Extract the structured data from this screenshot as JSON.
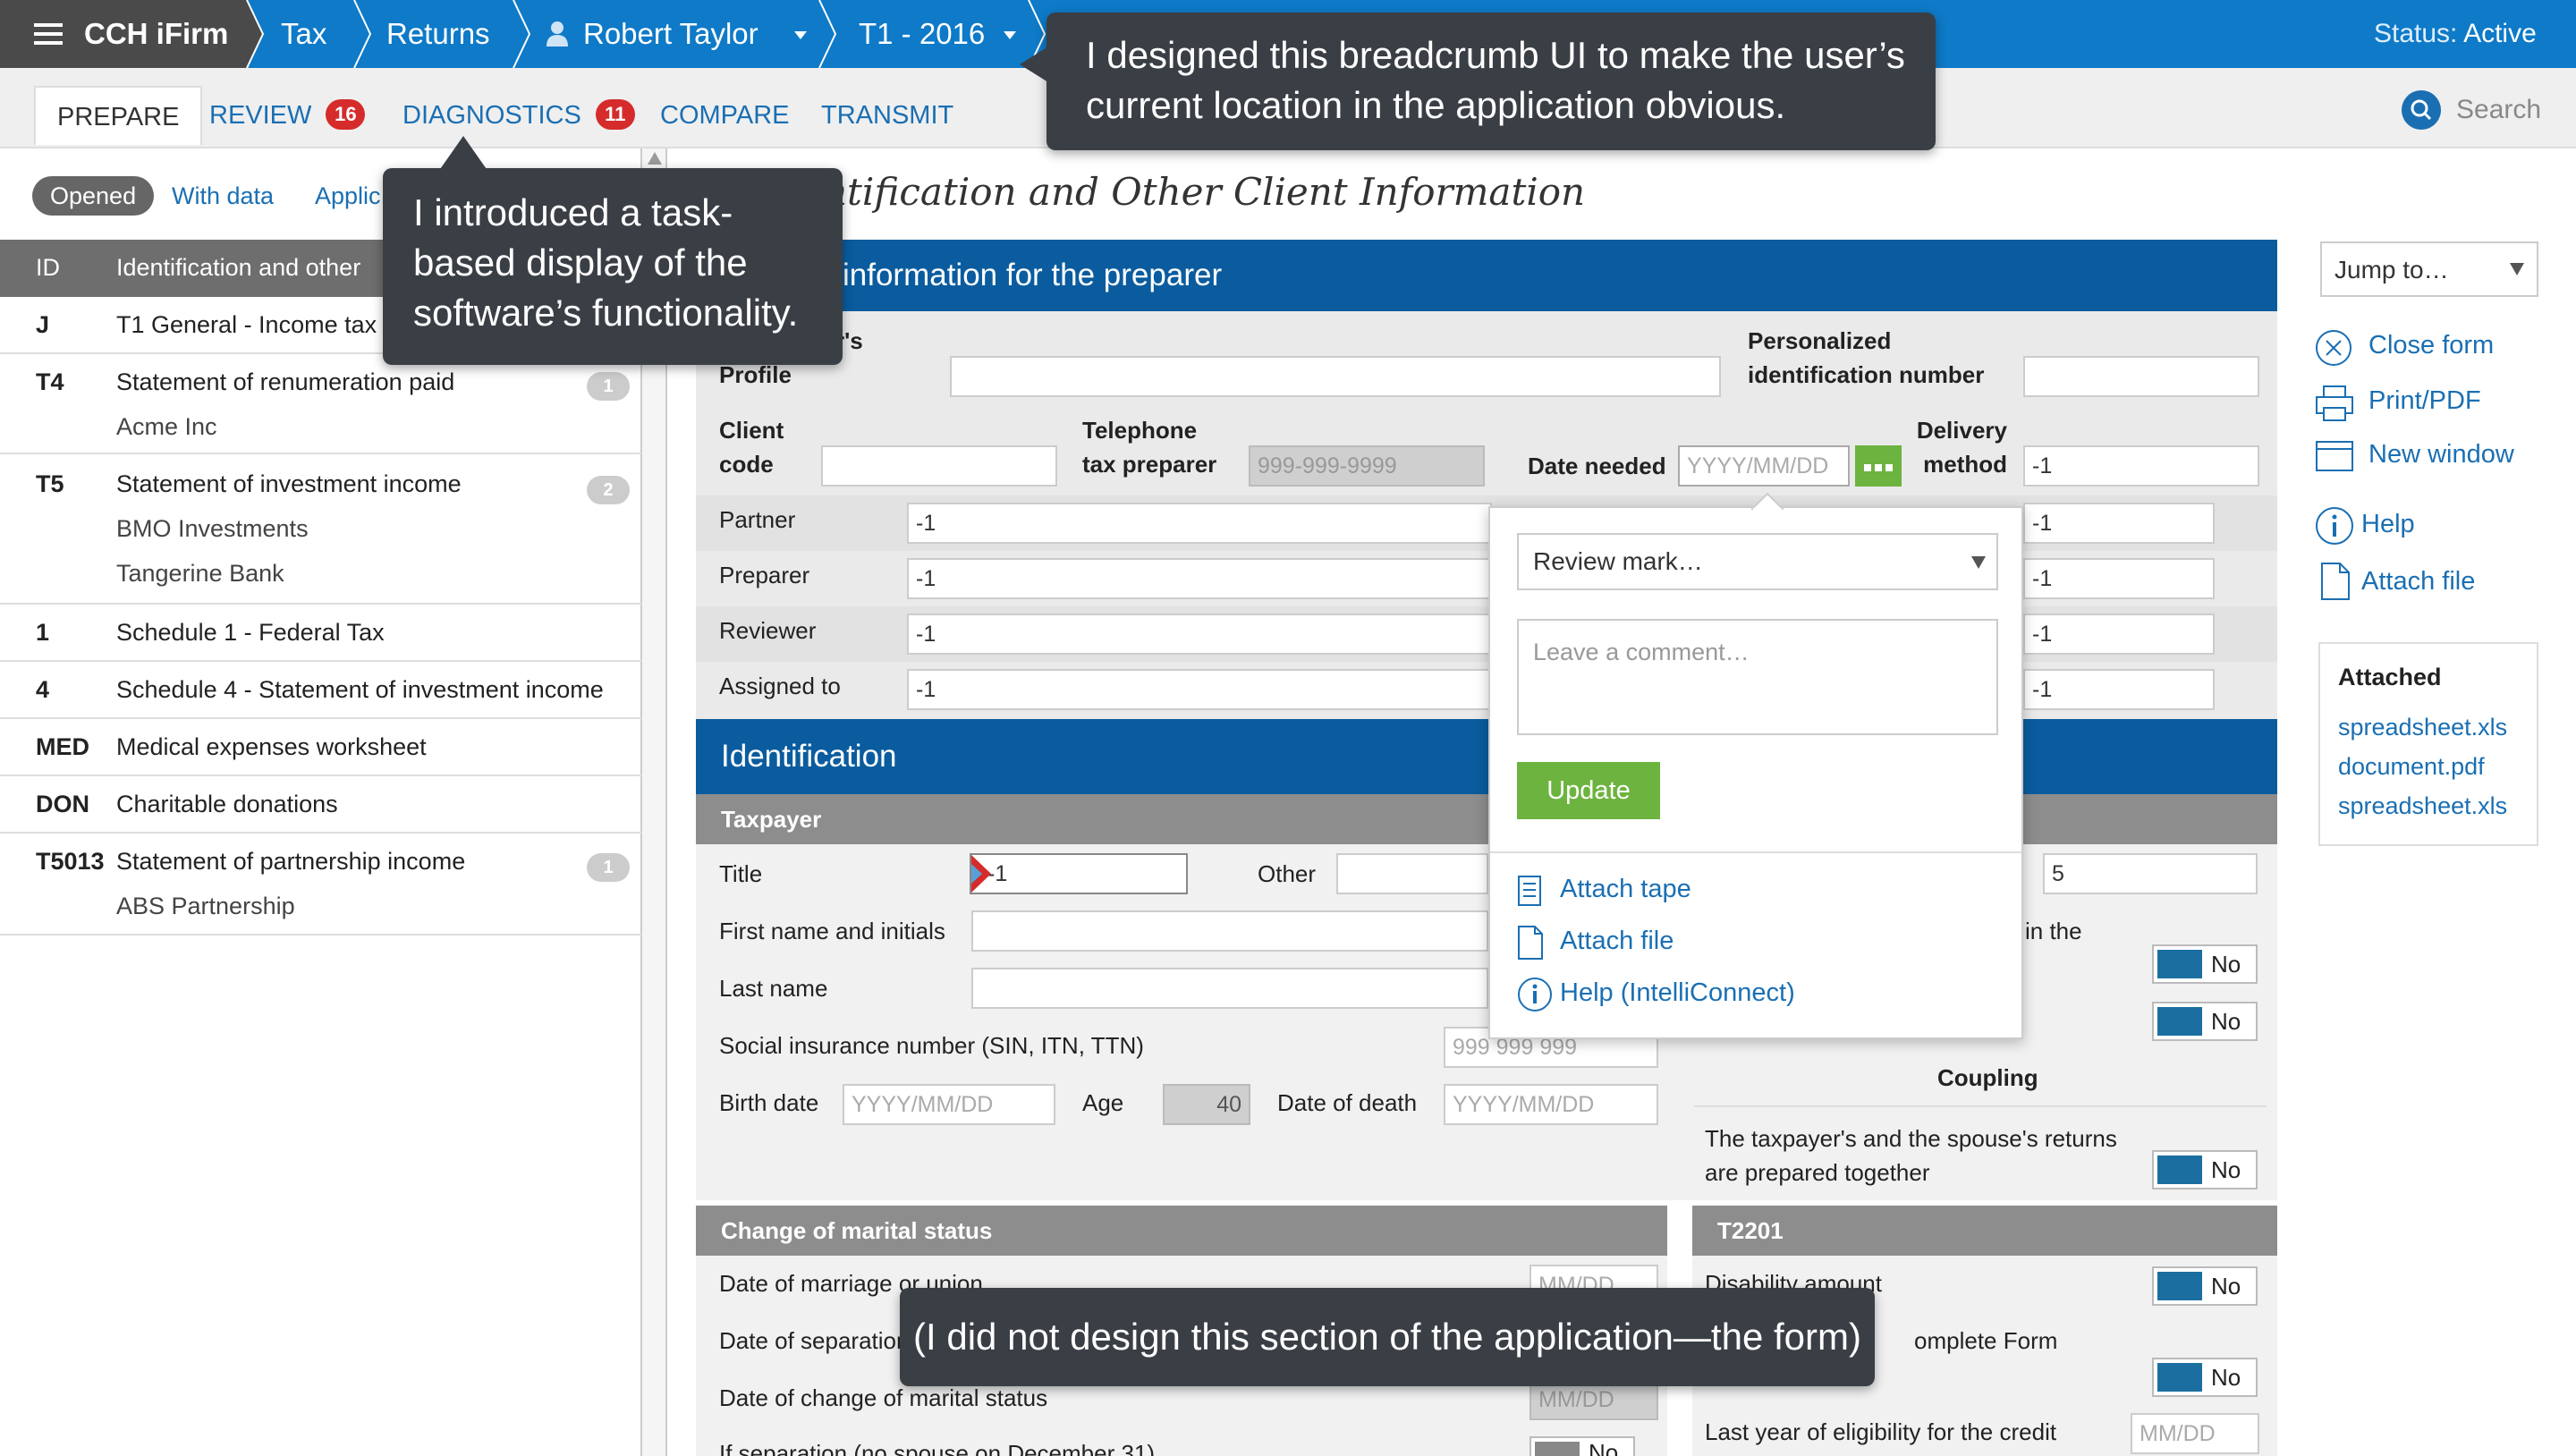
{
  "topbar": {
    "brand": "CCH iFirm",
    "crumbs": [
      "Tax",
      "Returns",
      "Robert Taylor",
      "T1 - 2016"
    ],
    "status_label": "Status:",
    "status_value": "Active"
  },
  "tabs": [
    {
      "label": "PREPARE",
      "active": true
    },
    {
      "label": "REVIEW",
      "badge": "16"
    },
    {
      "label": "DIAGNOSTICS",
      "badge": "11"
    },
    {
      "label": "COMPARE"
    },
    {
      "label": "TRANSMIT"
    }
  ],
  "search_label": "Search",
  "filters": [
    "Opened",
    "With data",
    "Applic"
  ],
  "list": {
    "header_code": "ID",
    "header_name": "Identification and other",
    "rows": [
      {
        "code": "J",
        "name": "T1 General - Income tax"
      },
      {
        "code": "T4",
        "name": "Statement of renumeration paid",
        "subs": [
          "Acme Inc"
        ],
        "count": "1"
      },
      {
        "code": "T5",
        "name": "Statement of investment income",
        "subs": [
          "BMO Investments",
          "Tangerine Bank"
        ],
        "count": "2"
      },
      {
        "code": "1",
        "name": "Schedule 1 - Federal Tax"
      },
      {
        "code": "4",
        "name": "Schedule 4 - Statement of investment income"
      },
      {
        "code": "MED",
        "name": "Medical expenses worksheet"
      },
      {
        "code": "DON",
        "name": "Charitable donations"
      },
      {
        "code": "T5013",
        "name": "Statement of partnership income",
        "subs": [
          "ABS Partnership"
        ],
        "count": "1"
      }
    ]
  },
  "form": {
    "title": "ntification and Other Client Information",
    "section1": "information for the preparer",
    "profile_label": [
      "r's",
      "Profile"
    ],
    "pin_label": [
      "Personalized",
      "identification number"
    ],
    "client_code_label": [
      "Client",
      "code"
    ],
    "telephone_label": [
      "Telephone",
      "tax preparer"
    ],
    "telephone_placeholder": "999-999-9999",
    "date_needed_label": "Date needed",
    "date_placeholder": "YYYY/MM/DD",
    "delivery_label": [
      "Delivery",
      "method"
    ],
    "delivery_value": "-1",
    "staff": [
      {
        "label": "Partner",
        "value": "-1",
        "right": "-1"
      },
      {
        "label": "Preparer",
        "value": "-1",
        "right": "-1"
      },
      {
        "label": "Reviewer",
        "value": "-1",
        "right": "-1"
      },
      {
        "label": "Assigned to",
        "value": "-1",
        "right": "-1"
      }
    ],
    "section2": "Identification",
    "taxpayer_bar": "Taxpayer",
    "title_label": "Title",
    "title_value": "-1",
    "other_label": "Other",
    "right_num": "5",
    "first_name_label": "First name and initials",
    "in_the_label": "in the",
    "last_name_label": "Last name",
    "sin_label": "Social insurance number (SIN, ITN, TTN)",
    "sin_placeholder": "999 999 999",
    "birth_label": "Birth date",
    "age_label": "Age",
    "age_value": "40",
    "death_label": "Date of death",
    "no": "No",
    "coupling": "Coupling",
    "coupling_text": [
      "The taxpayer's and the spouse's returns",
      "are prepared together"
    ],
    "marital_bar": "Change of marital status",
    "t2201_bar": "T2201",
    "marriage_label": "Date of marriage or union",
    "mmdd": "MM/DD",
    "separation_label": "Date of separation",
    "change_label": "Date of change of marital status",
    "ifsep_label": "If separation (no spouse on December 31)",
    "disability_label": "Disability amount",
    "complete_label": "omplete Form",
    "last_year_label": "Last year of eligibility for the credit"
  },
  "popup": {
    "select": "Review mark…",
    "comment_placeholder": "Leave a comment…",
    "update": "Update",
    "links": [
      "Attach tape",
      "Attach file",
      "Help (IntelliConnect)"
    ]
  },
  "sidebar": {
    "jump": "Jump to…",
    "links": [
      "Close form",
      "Print/PDF",
      "New window",
      "Help",
      "Attach file"
    ],
    "attached_title": "Attached",
    "attached": [
      "spreadsheet.xls",
      "document.pdf",
      "spreadsheet.xls"
    ]
  },
  "callouts": {
    "breadcrumb": [
      "I designed this breadcrumb UI to make the user’s",
      "current location in the application obvious."
    ],
    "tasks": [
      "I introduced a task-",
      "based display of the",
      "software’s functionality."
    ],
    "form": "(I did not design this section of the application—the form)"
  },
  "colors": {
    "brand_blue": "#0e7ac8",
    "section_blue": "#0a5c9e",
    "badge_red": "#d62b2b",
    "update_green": "#6db33f"
  }
}
